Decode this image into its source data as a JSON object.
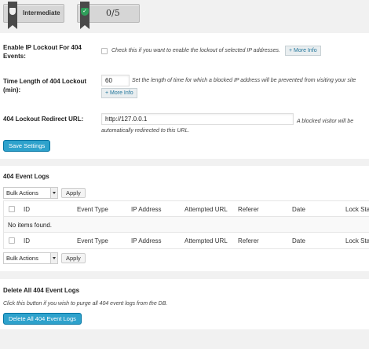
{
  "badges": {
    "level": "Intermediate",
    "score": "0/5"
  },
  "settings": {
    "lockout": {
      "label": "Enable IP Lockout For 404 Events:",
      "description": "Check this if you want to enable the lockout of selected IP addresses.",
      "more_info": "+ More Info"
    },
    "time_length": {
      "label": "Time Length of 404 Lockout (min):",
      "value": "60",
      "description": "Set the length of time for which a blocked IP address will be prevented from visiting your site",
      "more_info": "+ More Info"
    },
    "redirect": {
      "label": "404 Lockout Redirect URL:",
      "value": "http://127.0.0.1",
      "description": "A blocked visitor will be automatically redirected to this URL."
    },
    "save_label": "Save Settings"
  },
  "event_logs": {
    "title": "404 Event Logs",
    "bulk_action": "Bulk Actions",
    "apply_label": "Apply",
    "columns": [
      "ID",
      "Event Type",
      "IP Address",
      "Attempted URL",
      "Referer",
      "Date",
      "Lock Sta"
    ],
    "empty_message": "No items found."
  },
  "delete_all": {
    "title": "Delete All 404 Event Logs",
    "description": "Click this button if you wish to purge all 404 event logs from the DB.",
    "button_label": "Delete All 404 Event Logs"
  },
  "colors": {
    "primary_button": "#2ea2cc",
    "badge_flag": "#4a4a4a",
    "badge_check": "#2f9e5a"
  }
}
